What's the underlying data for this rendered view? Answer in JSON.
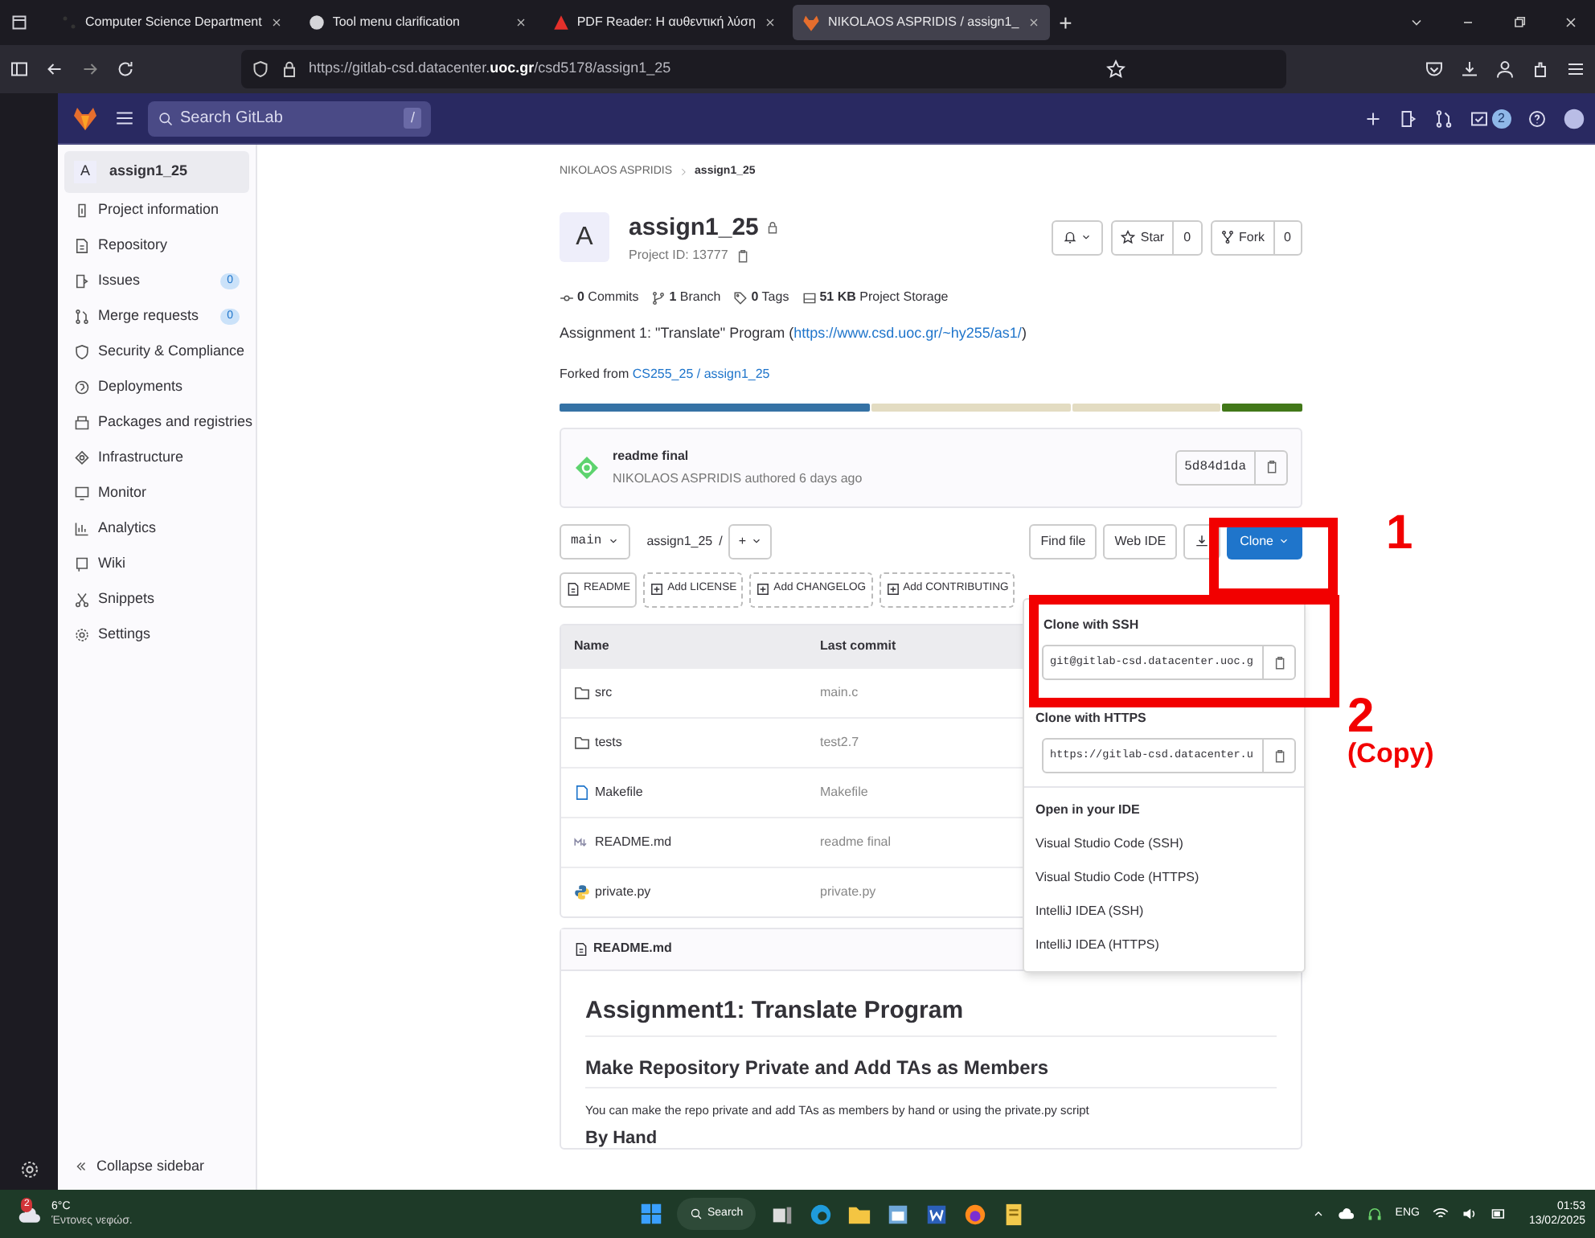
{
  "browser": {
    "tabs": [
      {
        "title": "Computer Science Department",
        "selected": false
      },
      {
        "title": "Tool menu clarification",
        "selected": false
      },
      {
        "title": "PDF Reader: Η αυθεντική λύση",
        "selected": false
      },
      {
        "title": "NIKOLAOS ASPRIDIS / assign1_",
        "selected": true
      }
    ],
    "new_tab": "+",
    "url": "https://gitlab-csd.datacenter.**uoc.gr**/csd5178/assign1_25"
  },
  "gitlab_header": {
    "search_placeholder": "Search GitLab",
    "shortcut": "/",
    "todo_count": "2"
  },
  "sidebar": {
    "project": {
      "avatar": "A",
      "name": "assign1_25",
      "selected": true
    },
    "items": [
      {
        "label": "Project information"
      },
      {
        "label": "Repository"
      },
      {
        "label": "Issues",
        "count": "0"
      },
      {
        "label": "Merge requests",
        "count": "0"
      },
      {
        "label": "Security & Compliance"
      },
      {
        "label": "Deployments"
      },
      {
        "label": "Packages and registries"
      },
      {
        "label": "Infrastructure"
      },
      {
        "label": "Monitor"
      },
      {
        "label": "Analytics"
      },
      {
        "label": "Wiki"
      },
      {
        "label": "Snippets"
      },
      {
        "label": "Settings"
      }
    ],
    "collapse": "Collapse sidebar"
  },
  "breadcrumb": [
    "NIKOLAOS ASPRIDIS",
    "assign1_25"
  ],
  "project": {
    "avatar": "A",
    "name": "assign1_25",
    "id": "Project ID: 13777",
    "star": "Star",
    "star_count": "0",
    "fork": "Fork",
    "fork_count": "0"
  },
  "stats": [
    "**0** Commits",
    "**1** Branch",
    "**0** Tags",
    "**51 KB** Project Storage"
  ],
  "description": {
    "prefix": "Assignment 1: \"Translate\" Program (",
    "link": "https://www.csd.uoc.gr/~hy255/as1/",
    "suffix": ")"
  },
  "forked": {
    "prefix": "Forked from",
    "link": "CS255_25 / assign1_25"
  },
  "languages": [
    {
      "color": "#3572a5"
    },
    {
      "color": "#e3dcc2"
    },
    {
      "color": "#e3dcc2"
    },
    {
      "color": "#427819"
    }
  ],
  "last_commit": {
    "title": "readme final",
    "author": "NIKOLAOS ASPRIDIS authored 6 days ago",
    "sha": "5d84d1da"
  },
  "toolbar": {
    "branch": "main",
    "path": "assign1_25",
    "separator": "/",
    "add": "+",
    "buttons": [
      "Find file",
      "Web IDE"
    ],
    "clone": "Clone"
  },
  "templates": [
    {
      "label": "README",
      "kind": "file"
    },
    {
      "label": "Add LICENSE",
      "kind": "add"
    },
    {
      "label": "Add CHANGELOG",
      "kind": "add"
    },
    {
      "label": "Add CONTRIBUTING",
      "kind": "add"
    }
  ],
  "files": {
    "columns": [
      "Name",
      "Last commit"
    ],
    "rows": [
      {
        "kind": "folder",
        "name": "src",
        "commit": "main.c"
      },
      {
        "kind": "folder",
        "name": "tests",
        "commit": "test2.7"
      },
      {
        "kind": "file",
        "name": "Makefile",
        "commit": "Makefile"
      },
      {
        "kind": "markdown",
        "name": "README.md",
        "commit": "readme final"
      },
      {
        "kind": "python",
        "name": "private.py",
        "commit": "private.py"
      }
    ]
  },
  "clone_menu": {
    "ssh_title": "Clone with SSH",
    "ssh_url": "git@gitlab-csd.datacenter.uoc.g",
    "https_title": "Clone with HTTPS",
    "https_url": "https://gitlab-csd.datacenter.u",
    "ide_title": "Open in your IDE",
    "ide_items": [
      "Visual Studio Code (SSH)",
      "Visual Studio Code (HTTPS)",
      "IntelliJ IDEA (SSH)",
      "IntelliJ IDEA (HTTPS)"
    ]
  },
  "readme": {
    "file": "README.md",
    "h1": "Assignment1: Translate Program",
    "h2": "Make Repository Private and Add TAs as Members",
    "p": "You can make the repo private and add TAs as members by hand or using the private.py script",
    "h3": "By Hand"
  },
  "annotations": [
    {
      "kind": "number",
      "text": "1"
    },
    {
      "kind": "number",
      "text": "2"
    },
    {
      "kind": "note",
      "text": "(Copy)"
    }
  ],
  "taskbar": {
    "temperature": "6°C",
    "weather": "Έντονες νεφώσ.",
    "weather_badge": "2",
    "search": "Search",
    "lang": "ENG",
    "time": "01:53",
    "date": "13/02/2025"
  }
}
